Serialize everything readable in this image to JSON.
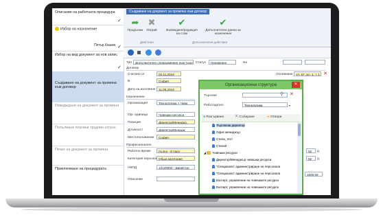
{
  "steps": [
    {
      "label": "Описание на работната процедура",
      "check": "✓"
    },
    {
      "label": "Избор на назначение",
      "sub": "Петър Кошев",
      "check": "✓"
    },
    {
      "label": "Избор на вид документ за нов запис",
      "check": "✓"
    },
    {
      "label": "Създаване на документ за промяна към договор"
    },
    {
      "label": "Изведждане на документ за промяна"
    },
    {
      "label": "Попълване плагини трудови отпуск"
    },
    {
      "label": "Печат на документ за промяна"
    },
    {
      "label": "Приключване на процедурата"
    }
  ],
  "ribbon": {
    "title": "Създаване на документ за промяна към договор",
    "btn_next": "Продължи",
    "btn_remove": "Изтрий",
    "btn_edit": "Въвеждане/редакция на стаж",
    "btn_extra": "Допълнителни данни за назначение",
    "group1": "Действия",
    "group2": "Допълнителни действия"
  },
  "form": {
    "type_label": "Тип",
    "type_value": "Допълнително споразумение към трудов договор",
    "status_label": "Статус",
    "status_value": "Неизведен",
    "no_label": "No",
    "contract_section": "Договор",
    "from_label": "Считано от",
    "from_value": "04.11.2019",
    "place_label": "В",
    "place_value": "София",
    "date_label": "Дата на изготвяне",
    "date_value": "11.09.2019",
    "basis_label": "Основание",
    "basis_value": "чл. 67, ал. 1, т. 1",
    "assign_section": "Назначение",
    "org_label": "Организация",
    "org_value": "Технологика > Чове",
    "unit_label": "Орг. единица",
    "unit_value": "Човешки ресурси",
    "pos_label": "Позиция",
    "pos_value": "Директор/Мениджъ",
    "role_label": "Длъжност",
    "role_value": "Директор/Менидж",
    "loc_label": "Местоположение",
    "loc_value": "София",
    "prof_section": "Професионален",
    "work_label": "Работно време",
    "work_value": "пълно - 8 часа",
    "cat_label": "Категория персонал",
    "cat_value": "Обща категория",
    "nkpd_label": "НКПД",
    "nkpd_value": "12126002 - Директор",
    "desc_label": "Описание",
    "small1": "92",
    "small2": "92",
    "unit_d": "д",
    "amount": "1600,00"
  },
  "modal": {
    "title": "Организационна структура",
    "search_label": "Търсене",
    "employer_label": "Работодател",
    "employer_value": "Технологика",
    "expand": "Разгърване",
    "collapse": "Събиране",
    "open": "Отвори",
    "tree": [
      {
        "label": "Търговски директор",
        "level": 1,
        "icon": "person",
        "sel": true
      },
      {
        "label": "Офис мениджър",
        "level": 1,
        "icon": "person"
      },
      {
        "label": "Стела_тест",
        "level": 1,
        "icon": "person"
      },
      {
        "label": "Стела2",
        "level": 1,
        "icon": "person"
      },
      {
        "label": "Човешки ресурси",
        "level": 0,
        "icon": "folder"
      },
      {
        "label": "Директор/Мениджър човешки ресурси",
        "level": 1,
        "icon": "person"
      },
      {
        "label": "*Специалист администриране на персонала",
        "level": 1,
        "icon": "person"
      },
      {
        "label": "*Специалист администриране на персонала",
        "level": 1,
        "icon": "person"
      },
      {
        "label": "Експерт, управление на човешките ресурси",
        "level": 1,
        "icon": "person"
      },
      {
        "label": "Експерт, управление на човешките ресурси",
        "level": 1,
        "icon": "person"
      }
    ]
  },
  "colors": {
    "accent": "#3a6fb8",
    "modal_border": "#55b04a",
    "modal_title": "#7ec86a",
    "green_check": "#37a63c"
  }
}
